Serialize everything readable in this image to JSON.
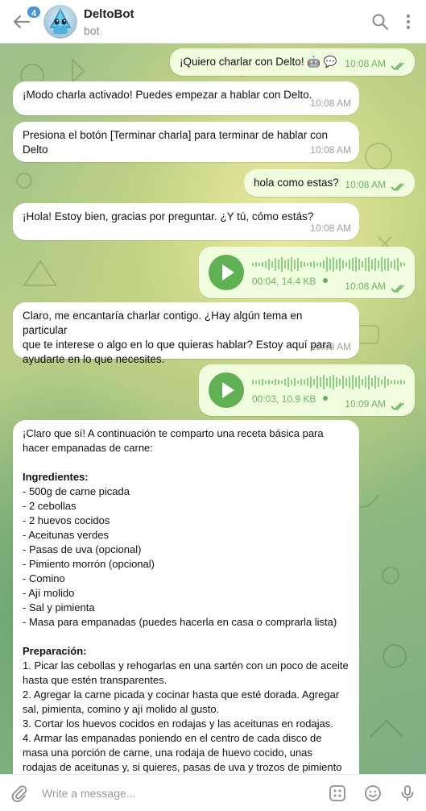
{
  "header": {
    "unread_count": "4",
    "title": "DeltoBot",
    "subtitle": "bot"
  },
  "messages": [
    {
      "dir": "out",
      "text": "¡Quiero charlar con Delto! 🤖 💬",
      "time": "10:08 AM"
    },
    {
      "dir": "in",
      "text": "¡Modo charla activado! Puedes empezar a hablar con Delto.",
      "time": "10:08 AM"
    },
    {
      "dir": "in",
      "text": "Presiona el botón [Terminar charla] para terminar de hablar con\nDelto",
      "time": "10:08 AM"
    },
    {
      "dir": "out",
      "text": "hola como estas?",
      "time": "10:08 AM"
    },
    {
      "dir": "in",
      "text": "¡Hola! Estoy bien, gracias por preguntar. ¿Y tú, cómo estás?",
      "time": "10:08 AM"
    },
    {
      "dir": "out",
      "voice_meta": "00:04, 14.4 KB",
      "time": "10:08 AM"
    },
    {
      "dir": "in",
      "text": "Claro, me encantaría charlar contigo. ¿Hay algún tema en particular\nque te interese o algo en lo que quieras hablar? Estoy aquí para\nayudarte en lo que necesites.",
      "time": "10:09 AM"
    },
    {
      "dir": "out",
      "voice_meta": "00:03, 10.9 KB",
      "time": "10:09 AM"
    }
  ],
  "recipe": {
    "intro": "¡Claro que sí! A continuación te comparto una receta básica para\nhacer empanadas de carne:",
    "ingredients_title": "Ingredientes:",
    "ingredients": [
      "- 500g de carne picada",
      "- 2 cebollas",
      "- 2 huevos cocidos",
      "- Aceitunas verdes",
      "- Pasas de uva (opcional)",
      "- Pimiento morrón (opcional)",
      "- Comino",
      "- Ají molido",
      "- Sal y pimienta",
      "- Masa para empanadas (puedes hacerla en casa o comprarla lista)"
    ],
    "prep_title": "Preparación:",
    "steps": [
      "1. Picar las cebollas y rehogarlas en una sartén con un poco de aceite",
      "hasta que estén transparentes.",
      "2. Agregar la carne picada y cocinar hasta que esté dorada. Agregar",
      "sal, pimienta, comino y ají molido al gusto.",
      "3. Cortar los huevos cocidos en rodajas y las aceitunas en rodajas.",
      "4. Armar las empanadas poniendo en el centro de cada disco de",
      "masa una porción de carne, una rodaja de huevo cocido, unas",
      "rodajas de aceitunas y, si quieres, pasas de uva y trozos de pimiento"
    ]
  },
  "input": {
    "placeholder": "Write a message..."
  },
  "colors": {
    "outgoing_bubble": "#effdde",
    "incoming_bubble": "#ffffff",
    "accent_green": "#5fb153",
    "badge_blue": "#4a95d6"
  }
}
